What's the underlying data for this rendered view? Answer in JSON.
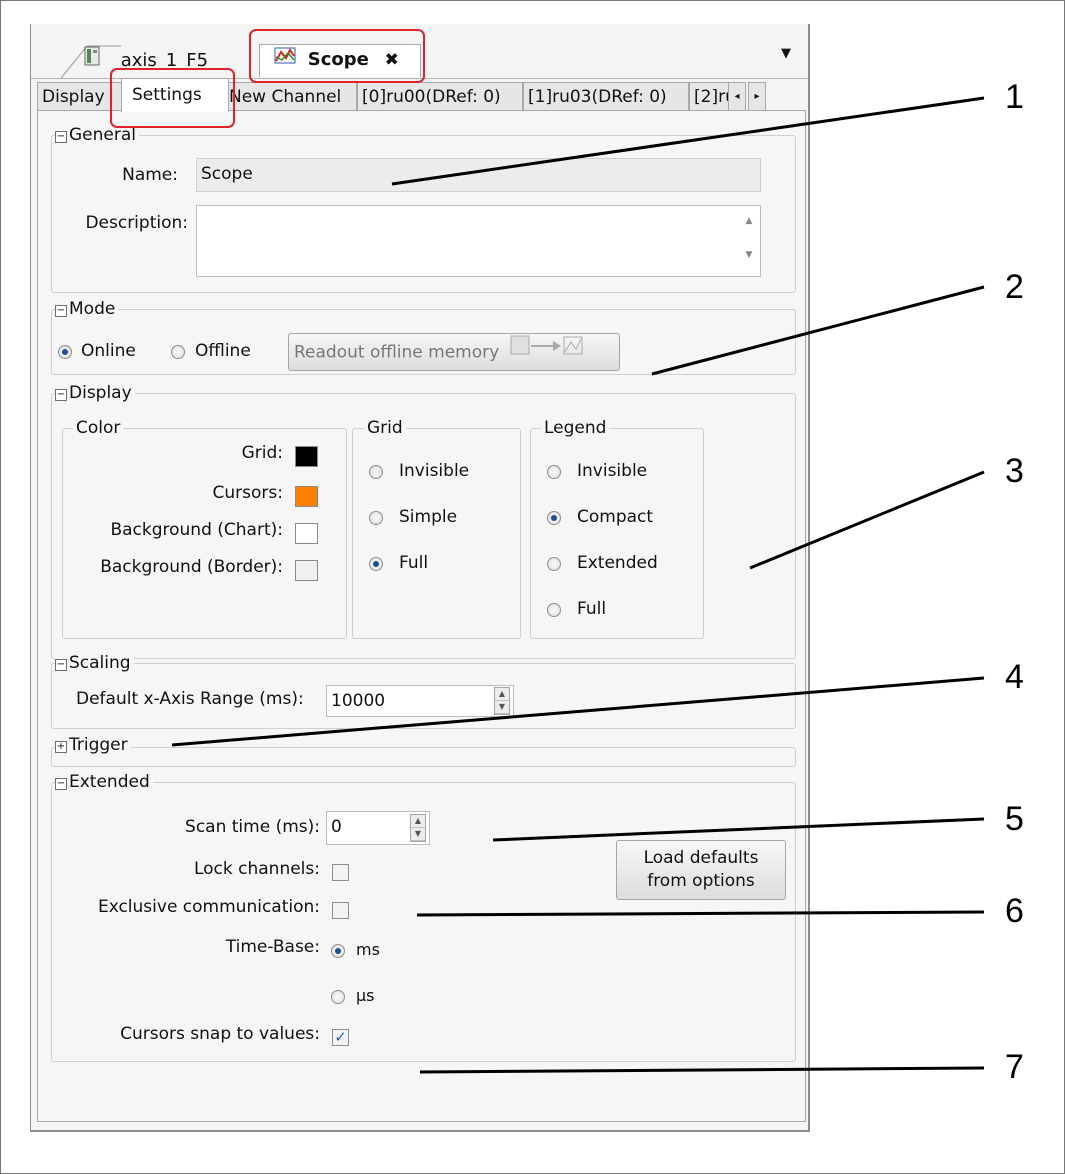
{
  "doc_tabs": [
    {
      "label": "axis_1_F5",
      "icon": "device-icon"
    },
    {
      "label": "Scope",
      "icon": "scope-icon",
      "close": "✖"
    }
  ],
  "tab_menu_glyph": "▼",
  "sub_tabs": [
    "Display",
    "Settings",
    "New Channel",
    "[0]ru00(DRef: 0)",
    "[1]ru03(DRef: 0)",
    "[2]ru"
  ],
  "scroll_left": "◂",
  "scroll_right": "▸",
  "general": {
    "title": "General",
    "collapse_glyph": "−",
    "name_label": "Name:",
    "name_value": "Scope",
    "description_label": "Description:",
    "description_value": ""
  },
  "mode": {
    "title": "Mode",
    "online": "Online",
    "offline": "Offline",
    "selected": "Online",
    "readout_button": "Readout offline memory"
  },
  "display": {
    "title": "Display",
    "color": {
      "title": "Color",
      "items": [
        {
          "label": "Grid:",
          "color": "#000000"
        },
        {
          "label": "Cursors:",
          "color": "#ff7f00"
        },
        {
          "label": "Background (Chart):",
          "color": "#ffffff"
        },
        {
          "label": "Background (Border):",
          "color": "#f0f0f0"
        }
      ]
    },
    "grid": {
      "title": "Grid",
      "options": [
        "Invisible",
        "Simple",
        "Full"
      ],
      "selected": "Full"
    },
    "legend": {
      "title": "Legend",
      "options": [
        "Invisible",
        "Compact",
        "Extended",
        "Full"
      ],
      "selected": "Compact"
    }
  },
  "scaling": {
    "title": "Scaling",
    "range_label": "Default x-Axis Range (ms):",
    "range_value": "10000"
  },
  "trigger": {
    "title": "Trigger",
    "expand_glyph": "+"
  },
  "extended": {
    "title": "Extended",
    "scan_label": "Scan time (ms):",
    "scan_value": "0",
    "lock_label": "Lock channels:",
    "lock_checked": false,
    "exclusive_label": "Exclusive communication:",
    "exclusive_checked": false,
    "timebase_label": "Time-Base:",
    "timebase_options": [
      "ms",
      "µs"
    ],
    "timebase_selected": "ms",
    "snap_label": "Cursors snap to values:",
    "snap_checked": true,
    "check_glyph": "✓",
    "defaults_button_line1": "Load defaults",
    "defaults_button_line2": "from options"
  },
  "callouts": [
    "1",
    "2",
    "3",
    "4",
    "5",
    "6",
    "7"
  ],
  "colors": {
    "highlight": "#e0222a",
    "radio_dot": "#1f4f8f",
    "check": "#2b5cb8"
  }
}
